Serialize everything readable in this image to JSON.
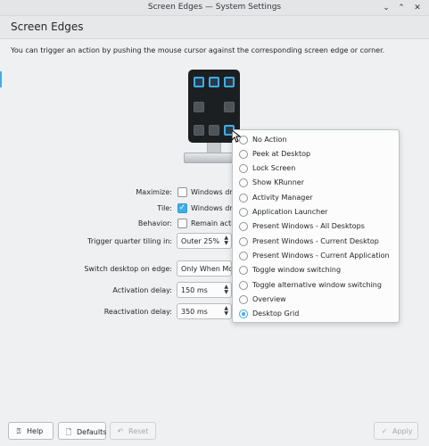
{
  "window": {
    "title": "Screen Edges — System Settings",
    "controls": {
      "minimize": "⌄",
      "maximize": "⌃",
      "close": "✕"
    }
  },
  "page": {
    "title": "Screen Edges",
    "description": "You can trigger an action by pushing the mouse cursor against the corresponding screen edge or corner."
  },
  "monitor": {
    "active_corners": [
      "top-left",
      "top-center",
      "top-right",
      "bottom-right"
    ]
  },
  "form": {
    "maximize": {
      "label": "Maximize:",
      "text": "Windows dra",
      "checked": false
    },
    "tile": {
      "label": "Tile:",
      "text": "Windows dra",
      "checked": true
    },
    "behavior": {
      "label": "Behavior:",
      "text": "Remain activ",
      "checked": false
    },
    "quarter_tiling": {
      "label": "Trigger quarter tiling in:",
      "value": "Outer 25%"
    },
    "switch_desktop": {
      "label": "Switch desktop on edge:",
      "value": "Only When Mov"
    },
    "activation_delay": {
      "label": "Activation delay:",
      "value": "150 ms"
    },
    "reactivation_delay": {
      "label": "Reactivation delay:",
      "value": "350 ms"
    }
  },
  "popup": {
    "options": [
      "No Action",
      "Peek at Desktop",
      "Lock Screen",
      "Show KRunner",
      "Activity Manager",
      "Application Launcher",
      "Present Windows - All Desktops",
      "Present Windows - Current Desktop",
      "Present Windows - Current Application",
      "Toggle window switching",
      "Toggle alternative window switching",
      "Overview",
      "Desktop Grid"
    ],
    "selected": "Desktop Grid"
  },
  "buttons": {
    "help": "Help",
    "defaults": "Defaults",
    "reset": "Reset",
    "apply": "Apply"
  },
  "colors": {
    "accent": "#3daee9",
    "background": "#eff0f1"
  }
}
